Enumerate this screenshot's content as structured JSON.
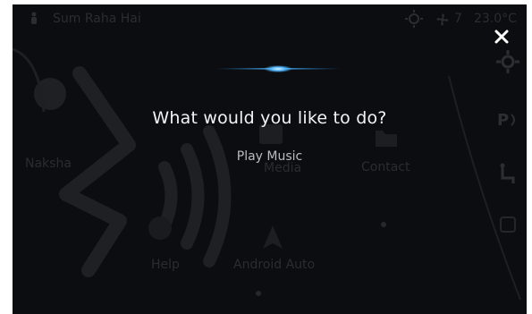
{
  "status_bar": {
    "location": "Sum Raha Hai",
    "fan_level": "7",
    "temperature": "23.0°C"
  },
  "background_apps": {
    "map_label": "Naksha",
    "media_label": "Media",
    "contact_label": "Contact",
    "help_label": "Help",
    "android_auto_label": "Android Auto"
  },
  "voice_assistant": {
    "prompt": "What would you like to do?",
    "suggestion": "Play Music"
  },
  "icons": [
    "close-icon",
    "sun-icon",
    "fan-icon",
    "settings-icon",
    "voice-wave-icon",
    "park-assist-icon",
    "seat-icon",
    "navigation-icon",
    "contact-icon",
    "music-icon"
  ],
  "colors": {
    "background": "#0c0d10",
    "text_primary": "#f2f3f5",
    "text_secondary": "#b9bcc1",
    "accent_glow": "#4fb6ff"
  }
}
